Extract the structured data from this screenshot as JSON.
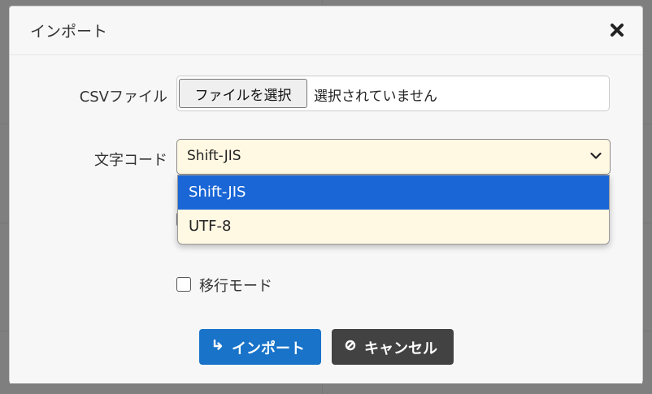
{
  "modal": {
    "title": "インポート"
  },
  "form": {
    "csv_label": "CSVファイル",
    "file_button_label": "ファイルを選択",
    "file_status": "選択されていません",
    "encoding_label": "文字コード",
    "encoding_selected": "Shift-JIS",
    "encoding_options": [
      "Shift-JIS",
      "UTF-8"
    ],
    "migration_mode_label": "移行モード",
    "migration_mode_checked": false
  },
  "buttons": {
    "import_label": "インポート",
    "cancel_label": "キャンセル"
  },
  "icons": {
    "close": "close-icon",
    "select_arrow": "chevron-down-icon",
    "import": "return-arrow-icon",
    "cancel": "prohibited-icon"
  },
  "colors": {
    "import_button": "#1873c9",
    "cancel_button": "#424242",
    "select_background": "#fff8e3",
    "option_highlight": "#1a66d6"
  }
}
